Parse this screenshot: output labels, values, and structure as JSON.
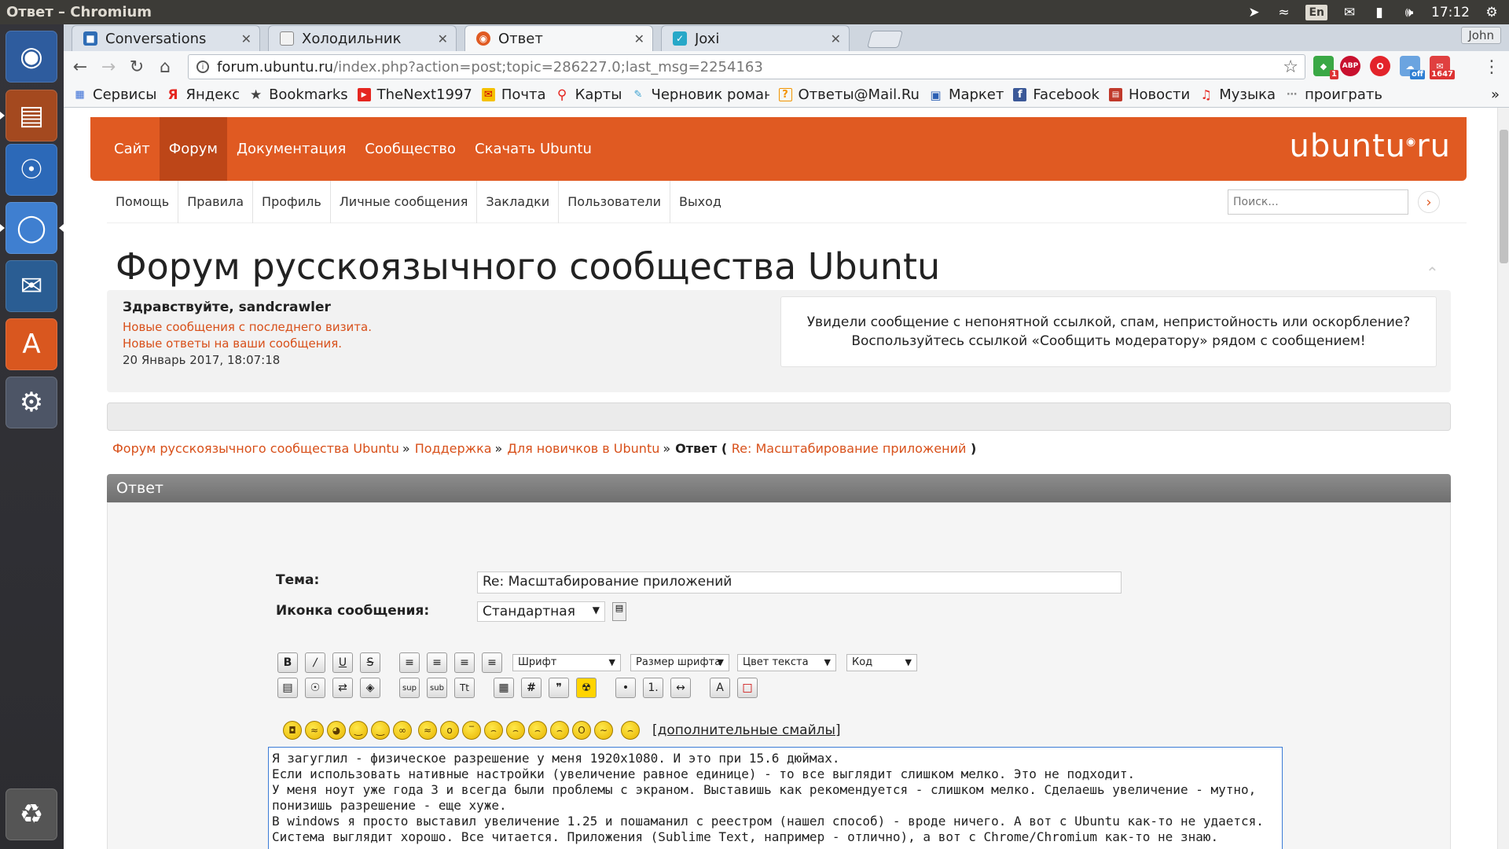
{
  "window": {
    "title": "Ответ – Chromium"
  },
  "panel": {
    "lang": "En",
    "time": "17:12"
  },
  "launcher": {
    "items": [
      "ubuntu-dash",
      "files",
      "chrome",
      "chromium",
      "thunderbird",
      "software-center",
      "system-settings",
      "trash"
    ]
  },
  "tabs": [
    {
      "label": "Conversations",
      "icon": "conversations-icon",
      "color": "#2f6db5"
    },
    {
      "label": "Холодильник",
      "icon": "page-icon",
      "color": "#888888"
    },
    {
      "label": "Ответ",
      "icon": "ubuntu-icon",
      "color": "#e05a22"
    },
    {
      "label": "Joxi",
      "icon": "joxi-icon",
      "color": "#27a8c8"
    }
  ],
  "profile": {
    "name": "John"
  },
  "address": {
    "host": "forum.ubuntu.ru",
    "path": "/index.php?action=post;topic=286227.0;last_msg=2254163"
  },
  "extensions": {
    "badge1": "1",
    "abp": "ABP",
    "off": "off",
    "count": "1647"
  },
  "bookmarks": [
    {
      "label": "Сервисы",
      "icon": "apps-grid-icon"
    },
    {
      "label": "Яндекс",
      "icon": "yandex-icon"
    },
    {
      "label": "Bookmarks",
      "icon": "star-icon"
    },
    {
      "label": "TheNext1997",
      "icon": "youtube-icon"
    },
    {
      "label": "Почта",
      "icon": "mail-icon"
    },
    {
      "label": "Карты",
      "icon": "map-pin-icon"
    },
    {
      "label": "Черновик роман",
      "icon": "pen-icon"
    },
    {
      "label": "Ответы@Mail.Ru",
      "icon": "question-icon"
    },
    {
      "label": "Маркет",
      "icon": "cart-icon"
    },
    {
      "label": "Facebook",
      "icon": "facebook-icon"
    },
    {
      "label": "Новости",
      "icon": "news-icon"
    },
    {
      "label": "Музыка",
      "icon": "music-icon"
    },
    {
      "label": "проиграть",
      "icon": "dots-icon"
    }
  ],
  "site": {
    "nav": [
      "Сайт",
      "Форум",
      "Документация",
      "Сообщество",
      "Скачать Ubuntu"
    ],
    "logo": "ubuntu",
    "logo_suffix": "ru",
    "subnav": [
      "Помощь",
      "Правила",
      "Профиль",
      "Личные сообщения",
      "Закладки",
      "Пользователи",
      "Выход"
    ],
    "search_placeholder": "Поиск...",
    "forum_title": "Форум русскоязычного сообщества Ubuntu"
  },
  "user": {
    "greeting": "Здравствуйте, sandcrawler",
    "new_posts": "Новые сообщения с последнего визита.",
    "new_replies": "Новые ответы на ваши сообщения.",
    "date": "20 Январь 2017, 18:07:18",
    "notice_line1": "Увидели сообщение с непонятной ссылкой, спам, непристойность или оскорбление?",
    "notice_line2": "Воспользуйтесь ссылкой «Сообщить модератору» рядом с сообщением!"
  },
  "breadcrumb": {
    "items": [
      "Форум русскоязычного сообщества Ubuntu",
      "Поддержка",
      "Для новичков в Ubuntu"
    ],
    "separator": "»",
    "current": "Ответ",
    "topic": "Re: Масштабирование приложений"
  },
  "reply": {
    "header": "Ответ",
    "subject_label": "Тема:",
    "subject_value": "Re: Масштабирование приложений",
    "icon_label": "Иконка сообщения:",
    "icon_value": "Стандартная",
    "font_label": "Шрифт",
    "size_label": "Размер шрифта",
    "color_label": "Цвет текста",
    "code_label": "Код",
    "more_smileys": "[дополнительные смайлы]",
    "message": "Я загуглил - физическое разрешение у меня 1920x1080. И это при 15.6 дюймах.\nЕсли использовать нативные настройки (увеличение равное единице) - то все выглядит слишком мелко. Это не подходит.\nУ меня ноут уже года 3 и всегда были проблемы с экраном. Выставишь как рекомендуется - слишком мелко. Сделаешь увеличение - мутно, понизишь разрешение - еще хуже.\nВ windows я просто выставил увеличение 1.25 и пошаманил с реестром (нашел способ) - вроде ничего. А вот с Ubuntu как-то не удается. Система выглядит хорошо. Все читается. Приложения (Sublime Text, например - отлично), а вот с Chrome/Chromium как-то не знаю."
  }
}
